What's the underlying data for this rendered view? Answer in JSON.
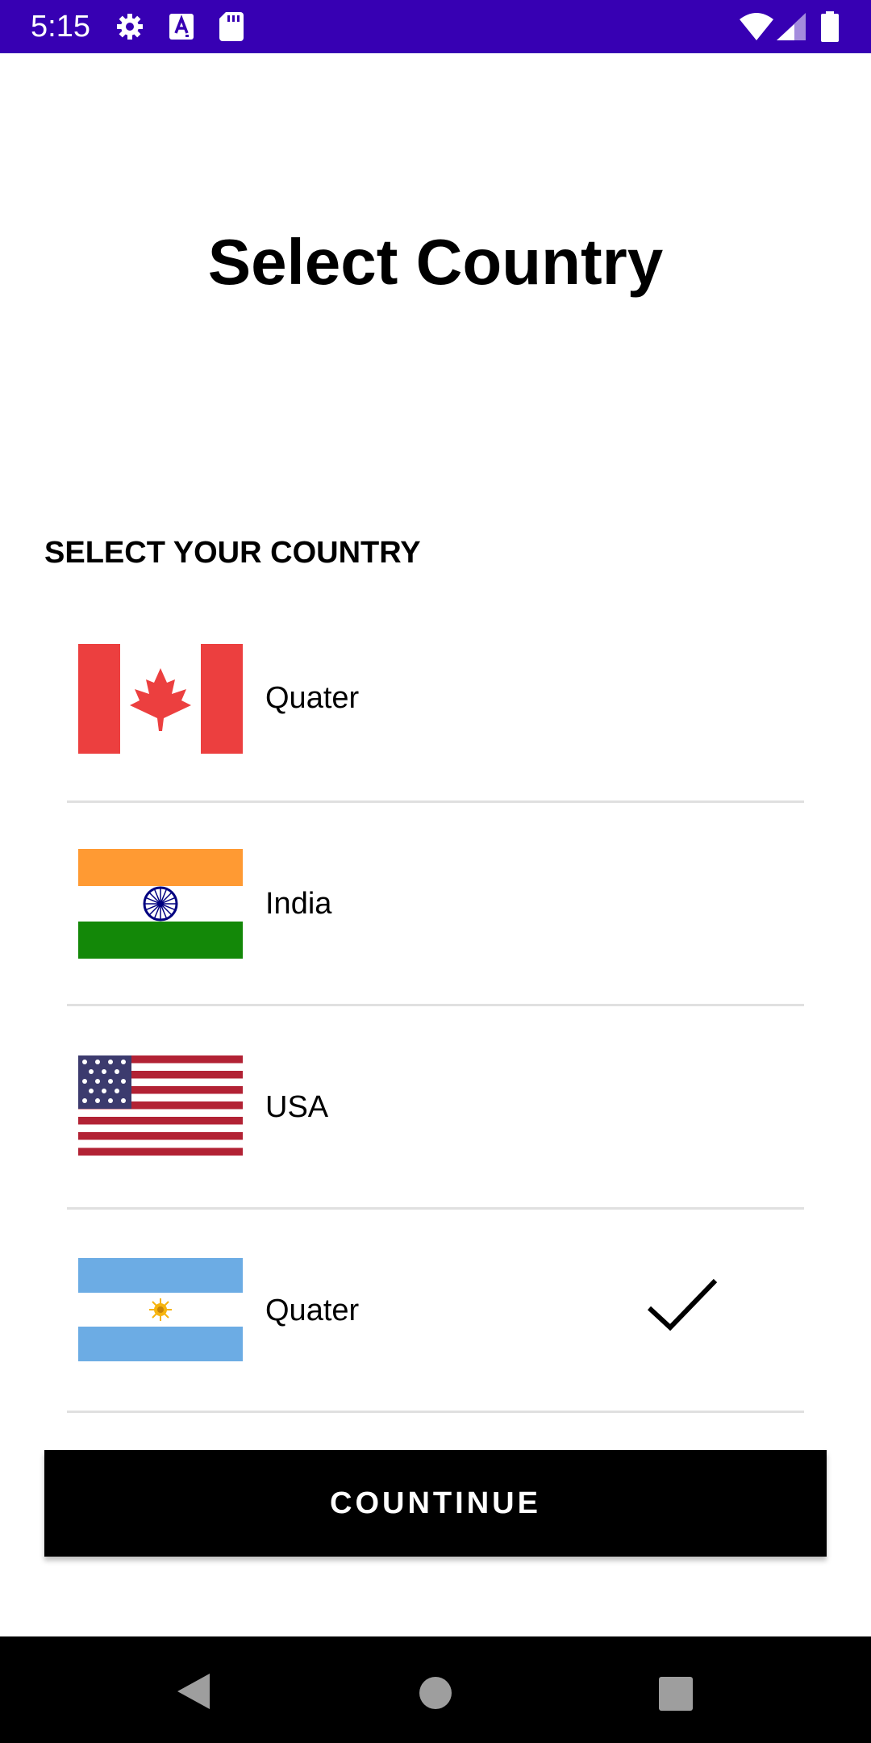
{
  "status_bar": {
    "time": "5:15",
    "icons": [
      "gear-icon",
      "text-a-icon",
      "sd-card-icon",
      "wifi-icon",
      "signal-icon",
      "battery-icon"
    ],
    "background_color": "#3700b3"
  },
  "page": {
    "title": "Select Country"
  },
  "section": {
    "label": "SELECT YOUR COUNTRY"
  },
  "countries": [
    {
      "name": "Quater",
      "flag": "canada-flag-icon",
      "selected": false
    },
    {
      "name": "India",
      "flag": "india-flag-icon",
      "selected": false
    },
    {
      "name": "USA",
      "flag": "usa-flag-icon",
      "selected": false
    },
    {
      "name": "Quater",
      "flag": "argentina-flag-icon",
      "selected": true
    }
  ],
  "continue_button": {
    "label": "COUNTINUE"
  },
  "nav_bar": {
    "icons": [
      "back-icon",
      "home-icon",
      "recents-icon"
    ]
  }
}
